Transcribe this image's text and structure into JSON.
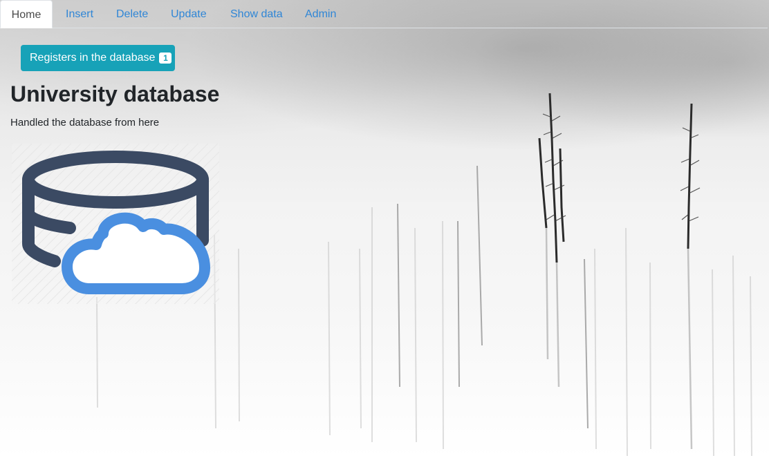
{
  "nav": {
    "tabs": [
      {
        "label": "Home",
        "active": true
      },
      {
        "label": "Insert",
        "active": false
      },
      {
        "label": "Delete",
        "active": false
      },
      {
        "label": "Update",
        "active": false
      },
      {
        "label": "Show data",
        "active": false
      },
      {
        "label": "Admin",
        "active": false
      }
    ]
  },
  "registers_button": {
    "label": "Registers in the database",
    "count": "1"
  },
  "page": {
    "title": "University database",
    "subtitle": "Handled the database from here"
  },
  "icons": {
    "hero": "database-cloud-icon"
  },
  "colors": {
    "link": "#2f86d6",
    "info_button": "#17a2b8",
    "db_icon_dark": "#3b4a63",
    "db_icon_cloud": "#4a8fe0"
  }
}
